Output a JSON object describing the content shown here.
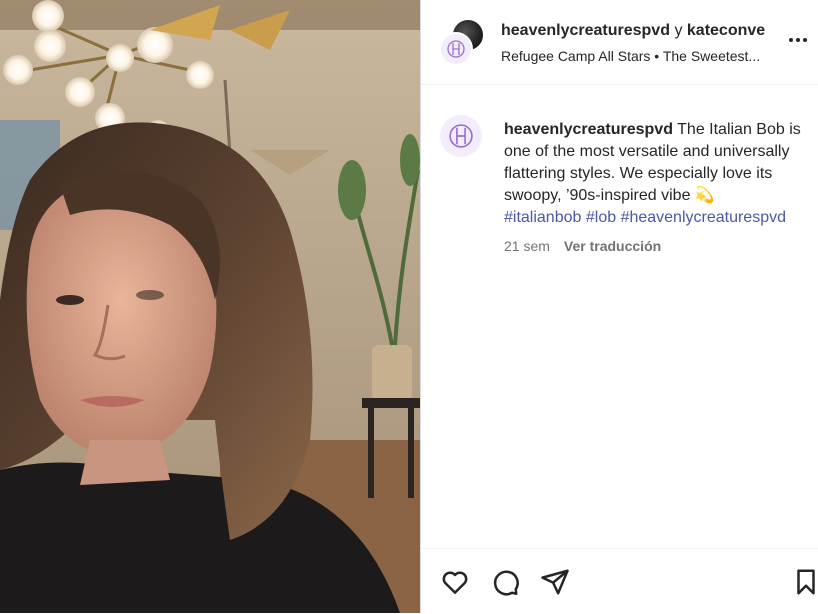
{
  "header": {
    "primary_user": "heavenlycreaturespvd",
    "connector": "y",
    "secondary_user": "kateconve",
    "audio": "Refugee Camp All Stars • The Sweetest..."
  },
  "caption": {
    "username": "heavenlycreaturespvd",
    "text": "The Italian Bob is one of the most versatile and universally flattering styles. We especially love its swoopy, ’90s-inspired vibe",
    "emoji": "💫",
    "hashtags": [
      "#italianbob",
      "#lob",
      "#heavenlycreaturespvd"
    ],
    "time": "21 sem",
    "translate": "Ver traducción"
  },
  "icons": {
    "more": "more-options-icon",
    "like": "heart-icon",
    "comment": "comment-icon",
    "share": "send-icon",
    "save": "bookmark-icon"
  },
  "colors": {
    "hashtag": "#4a58a8",
    "brand_logo": "#9b6fd1",
    "muted_text": "#737373"
  }
}
